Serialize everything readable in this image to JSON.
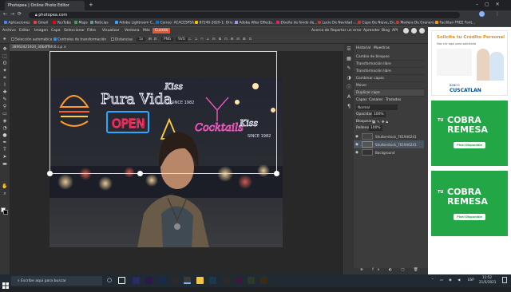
{
  "browser": {
    "tabs": [
      {
        "label": "Photopea | Online Photo Editor",
        "active": true
      },
      {
        "label": "+",
        "active": false
      }
    ],
    "url": "photopea.com",
    "bookmarks": [
      "Aplicaciones",
      "Gmail",
      "YouTube",
      "Maps",
      "Noticias",
      "Adobe Lightroom C...",
      "Correo: ACACESPSA...",
      "87240-2020-1: Driv...",
      "Adobe After Effects...",
      "Diseño de fondo de...",
      "Lucio De Navidad -...",
      "Cupo De Nieve, En...",
      "Madera De Granero...",
      "Facilitan FREE Font..."
    ]
  },
  "photopea": {
    "menu": [
      "Archivo",
      "Editar",
      "Imagen",
      "Capa",
      "Seleccionar",
      "Filtro",
      "Visualizar",
      "Ventana",
      "Más",
      "Cuenta"
    ],
    "menu_right": [
      "Acerca de",
      "Reportar un error",
      "Aprender",
      "Blog",
      "API"
    ],
    "options": {
      "auto_select": "Selección automática",
      "transform_controls": "Controles de transformación",
      "distances": "Distancias",
      "zoom": "1x",
      "png": "PNG",
      "svg": "SVG"
    },
    "document_tab": "38963421934_30b4ff6fc0.s.p",
    "history_tabs": [
      "Historial",
      "Muestras"
    ],
    "history": [
      "Cambio de bloqueo",
      "Transformación libre",
      "Transformación libre",
      "Combinar capas",
      "Mover",
      "Duplicar capa"
    ],
    "layer_tabs": [
      "Capas",
      "Canales",
      "Trazados"
    ],
    "blend_mode": "Normal",
    "opacity_label": "Opacidad:",
    "opacity_value": "100%",
    "lock_label": "Bloquear:",
    "fill_label": "Relleno:",
    "fill_value": "100%",
    "layers": [
      "Shutterstock_761946241",
      "Shutterstock_761946241",
      "Background"
    ],
    "neon_signs": [
      "Pura Vida",
      "OPEN",
      "Cocktails",
      "Kiss",
      "SINCE 1982"
    ]
  },
  "ads": {
    "ad1": {
      "title": "Solicita tu Crédito Personal",
      "subtitle": "Haz clic aquí para solicitarlo",
      "brand": "CUSCATLAN",
      "brand_prefix": "BANCO"
    },
    "ad2": {
      "line1": "COBRA",
      "line2": "REMESA",
      "prefix": "TU",
      "cta": "Pixel Disponible"
    },
    "ad3": {
      "line1": "COBRA",
      "line2": "REMESA",
      "prefix": "TU",
      "cta": "Pixel Disponible"
    }
  },
  "taskbar": {
    "search_placeholder": "Escribe aquí para buscar",
    "time": "11:52",
    "date": "21/5/2021",
    "lang": "ESP"
  },
  "colors": {
    "accent_menu": "#e05a3a",
    "remesa_green": "#23a646",
    "ad_orange": "#f28c00"
  }
}
